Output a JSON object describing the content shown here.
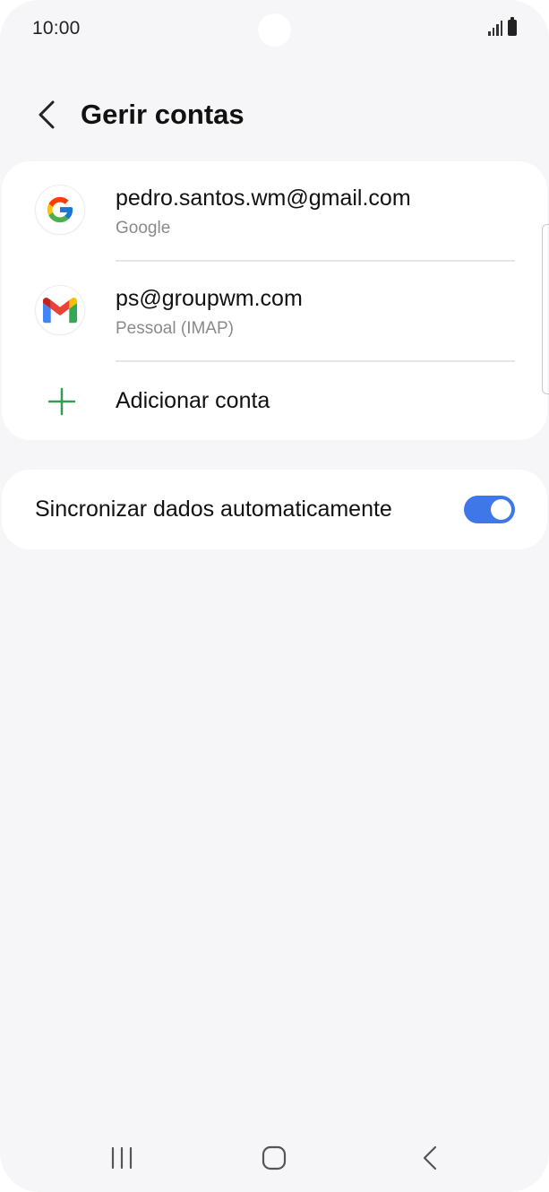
{
  "status_bar": {
    "time": "10:00"
  },
  "header": {
    "title": "Gerir contas"
  },
  "accounts": [
    {
      "email": "pedro.santos.wm@gmail.com",
      "type": "Google",
      "icon": "google-icon"
    },
    {
      "email": "ps@groupwm.com",
      "type": "Pessoal (IMAP)",
      "icon": "gmail-icon"
    }
  ],
  "add_account": {
    "label": "Adicionar conta",
    "icon": "plus-icon",
    "icon_color": "#3a9a55"
  },
  "sync": {
    "label": "Sincronizar dados automaticamente",
    "enabled": true,
    "toggle_color": "#3f76e8"
  },
  "nav": {
    "recents_icon": "recents-icon",
    "home_icon": "home-icon",
    "back_icon": "back-icon"
  }
}
